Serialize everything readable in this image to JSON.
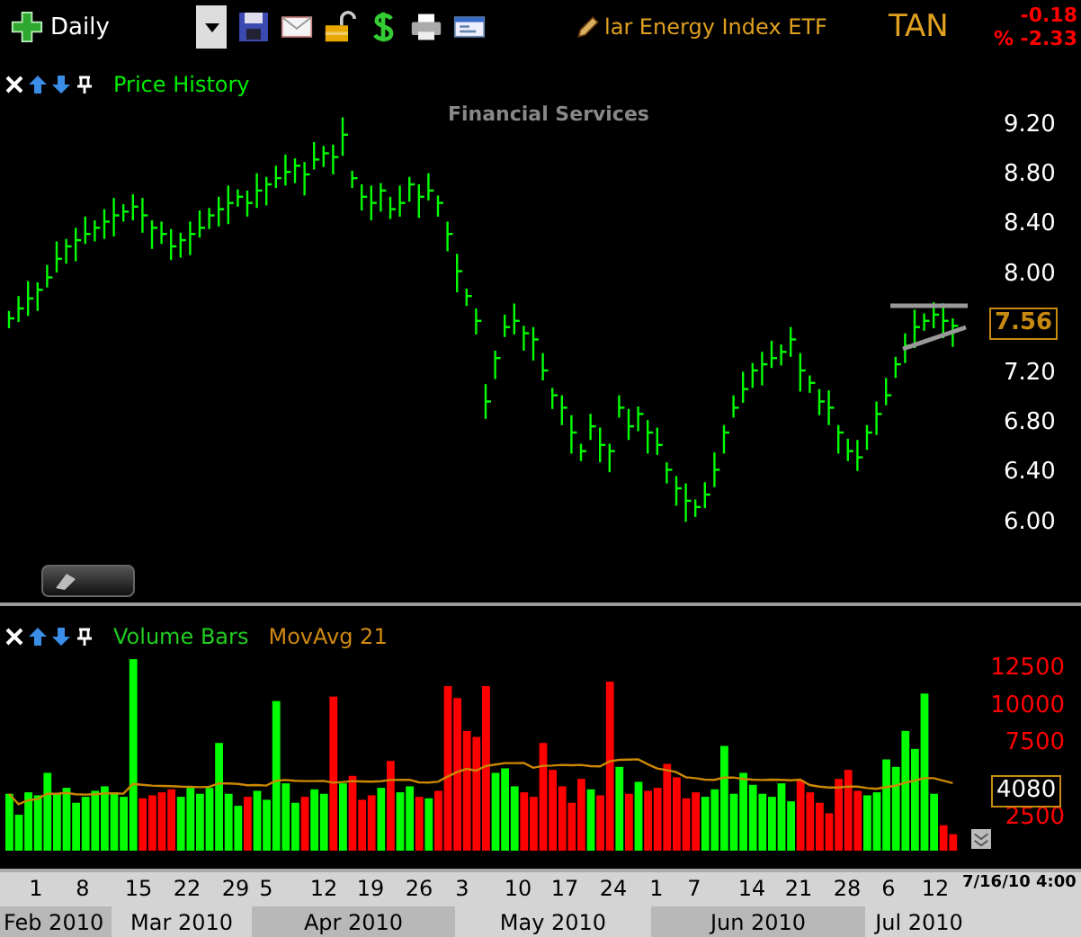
{
  "toolbar": {
    "period": "Daily",
    "title": "lar Energy Index ETF",
    "symbol": "TAN",
    "change": "-0.18",
    "change_pct": "% -2.33"
  },
  "price_panel": {
    "legend": "Price History",
    "sector": "Financial Services",
    "last_value": "7.56",
    "axis_labels": [
      "9.20",
      "8.80",
      "8.40",
      "8.00",
      "7.20",
      "6.80",
      "6.40",
      "6.00"
    ]
  },
  "volume_panel": {
    "legend": [
      {
        "label": "Volume Bars",
        "kind": "series"
      },
      {
        "label": "MovAvg 21",
        "kind": "average"
      }
    ],
    "last_value": "4080",
    "axis_labels": [
      "12500",
      "10000",
      "7500",
      "2500"
    ]
  },
  "date_axis": {
    "days": [
      "1",
      "8",
      "15",
      "22",
      "29",
      "5",
      "12",
      "19",
      "26",
      "3",
      "10",
      "17",
      "24",
      "1",
      "7",
      "14",
      "21",
      "28",
      "6",
      "12"
    ],
    "stamp": "7/16/10 4:00",
    "months": [
      {
        "label": "Feb 2010",
        "shaded": true
      },
      {
        "label": "Mar 2010",
        "shaded": false
      },
      {
        "label": "Apr 2010",
        "shaded": true
      },
      {
        "label": "May 2010",
        "shaded": false
      },
      {
        "label": "Jun 2010",
        "shaded": true
      },
      {
        "label": "Jul 2010",
        "shaded": false
      }
    ]
  }
}
